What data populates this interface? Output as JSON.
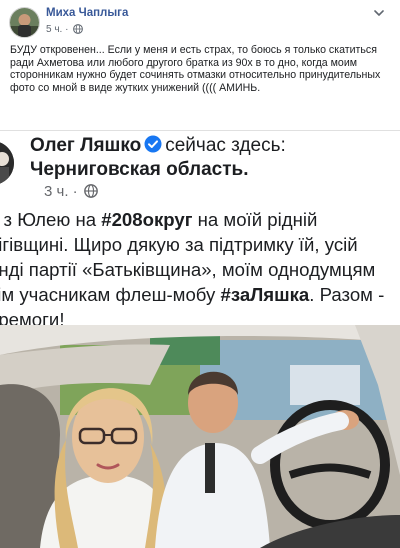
{
  "post": {
    "author": "Миха Чаплыга",
    "time": "5 ч.",
    "text": "БУДУ откровенен... Если у меня и есть страх, то боюсь я только скатиться ради Ахметова или любого другого братка из 90х в то дно, когда моим сторонникам нужно будет сочинять отмазки относительно принудительных фото со мной в виде жутких унижений ((((  АМИНЬ.",
    "icons": {
      "privacy": "globe-icon",
      "menu": "chevron-down-icon"
    }
  },
  "shared": {
    "name": "Олег Ляшко",
    "presence": "сейчас здесь:",
    "location": "Черниговская область.",
    "time": "3 ч.",
    "text_parts": {
      "p1": "о з Юлею на ",
      "tag1": "#208округ",
      "p2": " на моїй рідній нігівщині. Щиро дякую за підтримку їй, усій анді партії «Батьківщина», моїм однодумцям сім учасникам флеш-мобу ",
      "tag2": "#заЛяшка",
      "p3": ". Разом - еремоги!"
    },
    "icons": {
      "verified": "verified-badge-icon",
      "privacy": "globe-icon"
    },
    "colors": {
      "verified": "#1877f2",
      "link": "#385898"
    }
  }
}
